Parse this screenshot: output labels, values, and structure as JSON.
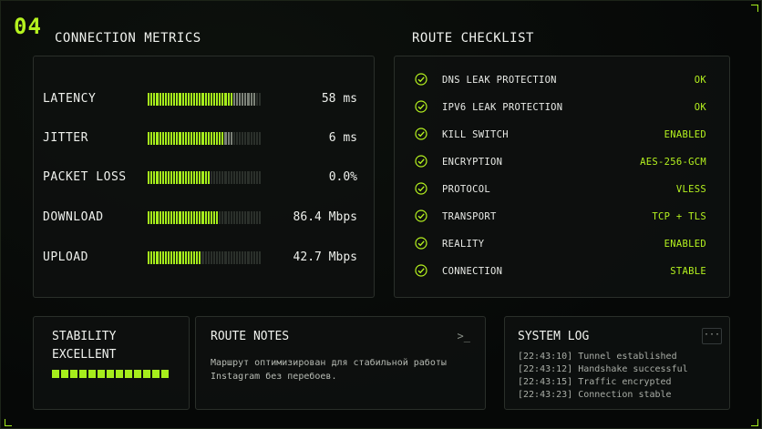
{
  "section_number": "04",
  "metrics": {
    "title": "CONNECTION METRICS",
    "rows": [
      {
        "label": "LATENCY",
        "value": "58 ms",
        "level": 0.75,
        "dim": 0.2
      },
      {
        "label": "JITTER",
        "value": "6 ms",
        "level": 0.68,
        "dim": 0.07
      },
      {
        "label": "PACKET LOSS",
        "value": "0.0%",
        "level": 0.55,
        "dim": 0.0
      },
      {
        "label": "DOWNLOAD",
        "value": "86.4 Mbps",
        "level": 0.62,
        "dim": 0.0
      },
      {
        "label": "UPLOAD",
        "value": "42.7 Mbps",
        "level": 0.48,
        "dim": 0.0
      }
    ]
  },
  "checklist": {
    "title": "ROUTE CHECKLIST",
    "items": [
      {
        "label": "DNS LEAK PROTECTION",
        "status": "OK"
      },
      {
        "label": "IPV6 LEAK PROTECTION",
        "status": "OK"
      },
      {
        "label": "KILL SWITCH",
        "status": "ENABLED"
      },
      {
        "label": "ENCRYPTION",
        "status": "AES-256-GCM"
      },
      {
        "label": "PROTOCOL",
        "status": "VLESS"
      },
      {
        "label": "TRANSPORT",
        "status": "TCP + TLS"
      },
      {
        "label": "REALITY",
        "status": "ENABLED"
      },
      {
        "label": "CONNECTION",
        "status": "STABLE"
      }
    ]
  },
  "stability": {
    "title": "STABILITY",
    "value": "EXCELLENT",
    "segments": 13,
    "level": 1.0
  },
  "notes": {
    "title": "ROUTE NOTES",
    "prompt": ">_",
    "text": "Маршрут оптимизирован для стабильной работы Instagram без перебоев."
  },
  "log": {
    "title": "SYSTEM LOG",
    "more": "···",
    "lines": [
      "[22:43:10] Tunnel established",
      "[22:43:12] Handshake successful",
      "[22:43:15] Traffic encrypted",
      "[22:43:23] Connection stable"
    ]
  },
  "colors": {
    "accent": "#b5f21f",
    "bar_on": "#a6ee1c",
    "bar_off": "#2b302b",
    "background": "#07090a"
  }
}
